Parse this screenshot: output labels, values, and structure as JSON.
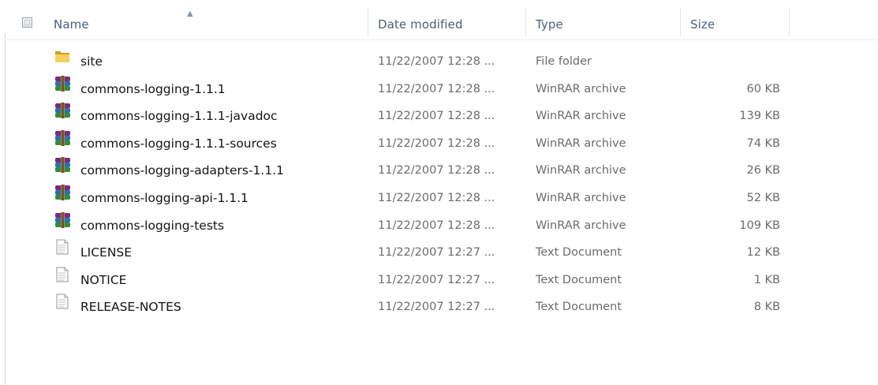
{
  "columns": {
    "name": "Name",
    "date": "Date modified",
    "type": "Type",
    "size": "Size"
  },
  "files": [
    {
      "name": "site",
      "date": "11/22/2007 12:28 ...",
      "type": "File folder",
      "size": "",
      "icon": "folder-icon"
    },
    {
      "name": "commons-logging-1.1.1",
      "date": "11/22/2007 12:28 ...",
      "type": "WinRAR archive",
      "size": "60 KB",
      "icon": "winrar-archive-icon"
    },
    {
      "name": "commons-logging-1.1.1-javadoc",
      "date": "11/22/2007 12:28 ...",
      "type": "WinRAR archive",
      "size": "139 KB",
      "icon": "winrar-archive-icon"
    },
    {
      "name": "commons-logging-1.1.1-sources",
      "date": "11/22/2007 12:28 ...",
      "type": "WinRAR archive",
      "size": "74 KB",
      "icon": "winrar-archive-icon"
    },
    {
      "name": "commons-logging-adapters-1.1.1",
      "date": "11/22/2007 12:28 ...",
      "type": "WinRAR archive",
      "size": "26 KB",
      "icon": "winrar-archive-icon"
    },
    {
      "name": "commons-logging-api-1.1.1",
      "date": "11/22/2007 12:28 ...",
      "type": "WinRAR archive",
      "size": "52 KB",
      "icon": "winrar-archive-icon"
    },
    {
      "name": "commons-logging-tests",
      "date": "11/22/2007 12:28 ...",
      "type": "WinRAR archive",
      "size": "109 KB",
      "icon": "winrar-archive-icon"
    },
    {
      "name": "LICENSE",
      "date": "11/22/2007 12:27 ...",
      "type": "Text Document",
      "size": "12 KB",
      "icon": "text-document-icon"
    },
    {
      "name": "NOTICE",
      "date": "11/22/2007 12:27 ...",
      "type": "Text Document",
      "size": "1 KB",
      "icon": "text-document-icon"
    },
    {
      "name": "RELEASE-NOTES",
      "date": "11/22/2007 12:27 ...",
      "type": "Text Document",
      "size": "8 KB",
      "icon": "text-document-icon"
    }
  ],
  "colors": {
    "header_text": "#4c607a",
    "name_text": "#141414",
    "meta_text": "#6b6b6b"
  }
}
